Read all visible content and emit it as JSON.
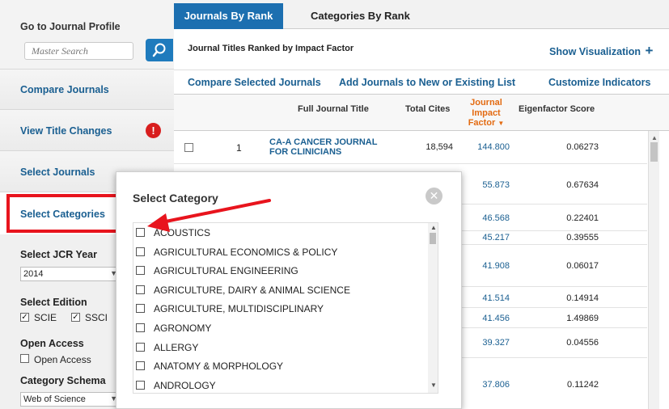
{
  "sidebar": {
    "profile_title": "Go to Journal Profile",
    "search_placeholder": "Master Search",
    "compare": "Compare Journals",
    "title_changes": "View Title Changes",
    "select_journals": "Select Journals",
    "select_categories": "Select Categories",
    "jcr_year_label": "Select JCR Year",
    "jcr_year_value": "2014",
    "edition_label": "Select Edition",
    "edition_scie": "SCIE",
    "edition_ssci": "SSCI",
    "open_access_label": "Open Access",
    "open_access_option": "Open Access",
    "schema_label": "Category Schema",
    "schema_value": "Web of Science"
  },
  "tabs": {
    "rank": "Journals By Rank",
    "categories": "Categories By Rank"
  },
  "header": {
    "ranked_title": "Journal Titles Ranked by Impact Factor",
    "show_vis": "Show Visualization"
  },
  "actions": {
    "compare": "Compare Selected Journals",
    "add": "Add Journals to New or Existing List",
    "customize": "Customize Indicators"
  },
  "table": {
    "headers": {
      "title": "Full Journal Title",
      "cites": "Total Cites",
      "jif1": "Journal",
      "jif2": "Impact",
      "jif3": "Factor",
      "eigen": "Eigenfactor Score"
    },
    "rows": [
      {
        "rank": "1",
        "title": "CA-A CANCER JOURNAL FOR CLINICIANS",
        "cites": "18,594",
        "jif": "144.800",
        "eigen": "0.06273"
      },
      {
        "rank": "",
        "title": "",
        "cites": "",
        "jif": "55.873",
        "eigen": "0.67634"
      },
      {
        "rank": "",
        "title": "",
        "cites": "",
        "jif": "46.568",
        "eigen": "0.22401"
      },
      {
        "rank": "",
        "title": "",
        "cites": "",
        "jif": "45.217",
        "eigen": "0.39555"
      },
      {
        "rank": "",
        "title": "",
        "cites": "",
        "jif": "41.908",
        "eigen": "0.06017"
      },
      {
        "rank": "",
        "title": "",
        "cites": "",
        "jif": "41.514",
        "eigen": "0.14914"
      },
      {
        "rank": "",
        "title": "",
        "cites": "",
        "jif": "41.456",
        "eigen": "1.49869"
      },
      {
        "rank": "",
        "title": "",
        "cites": "",
        "jif": "39.327",
        "eigen": "0.04556"
      },
      {
        "rank": "",
        "title": "",
        "cites": "",
        "jif": "37.806",
        "eigen": "0.11242"
      }
    ]
  },
  "modal": {
    "title": "Select Category",
    "categories": [
      "ACOUSTICS",
      "AGRICULTURAL ECONOMICS & POLICY",
      "AGRICULTURAL ENGINEERING",
      "AGRICULTURE, DAIRY & ANIMAL SCIENCE",
      "AGRICULTURE, MULTIDISCIPLINARY",
      "AGRONOMY",
      "ALLERGY",
      "ANATOMY & MORPHOLOGY",
      "ANDROLOGY"
    ]
  },
  "colors": {
    "brand_blue": "#1c6fb0",
    "link": "#1a5f91",
    "annotation_red": "#e8141d",
    "jif_orange": "#e36b12"
  },
  "icons": {
    "search": "search-icon",
    "warning": "warning-icon",
    "close": "close-icon",
    "plus": "plus-icon"
  }
}
